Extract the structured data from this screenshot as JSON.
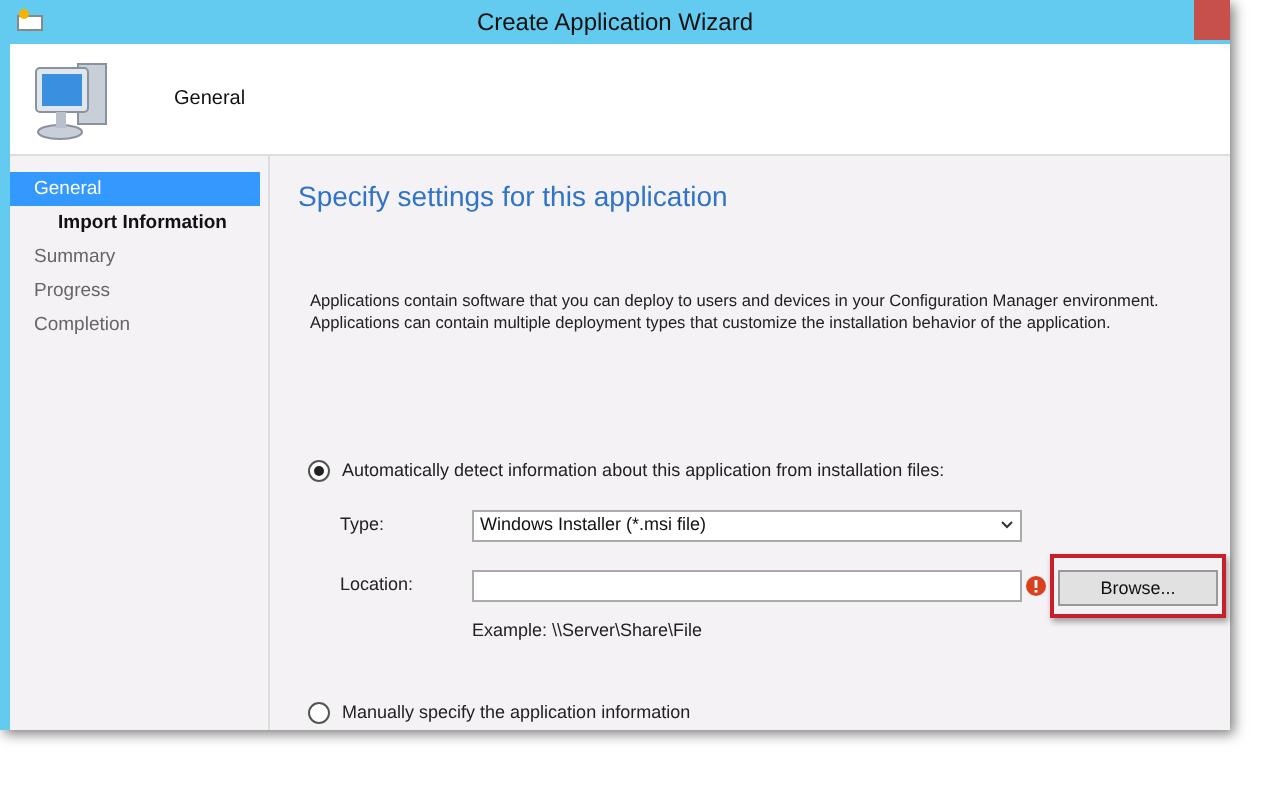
{
  "window": {
    "title": "Create Application Wizard"
  },
  "header": {
    "title": "General"
  },
  "steps": [
    {
      "label": "General",
      "selected": true,
      "children": [
        {
          "label": "Import Information",
          "selected": false
        }
      ]
    },
    {
      "label": "Summary",
      "selected": false
    },
    {
      "label": "Progress",
      "selected": false
    },
    {
      "label": "Completion",
      "selected": false
    }
  ],
  "heading": "Specify settings for this application",
  "description": [
    "Applications contain software that you can deploy to users and devices in your Configuration Manager environment.",
    "Applications can contain multiple deployment types that customize the installation behavior of the application."
  ],
  "auto_option": {
    "label": "Automatically detect information about this application from installation files:",
    "selected": true
  },
  "type_field": {
    "label": "Type:",
    "value": "Windows Installer (*.msi file)"
  },
  "location_field": {
    "label": "Location:",
    "error": true,
    "example": "Example: \\\\Server\\Share\\File"
  },
  "browse_button": {
    "label": "Browse...",
    "highlighted": true
  },
  "manual_option": {
    "label": "Manually specify the application information",
    "selected": false
  }
}
